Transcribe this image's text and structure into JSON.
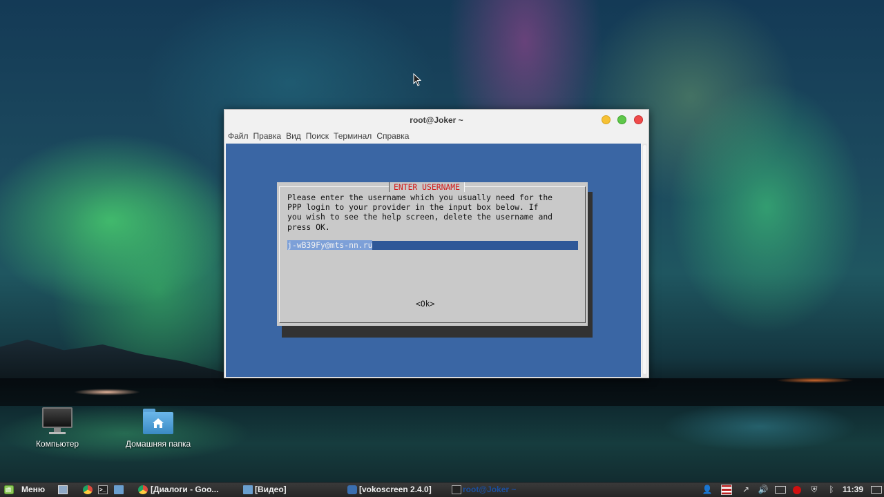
{
  "desktop": {
    "icons": [
      {
        "label": "Компьютер"
      },
      {
        "label": "Домашняя папка"
      }
    ]
  },
  "window": {
    "title": "root@Joker ~",
    "menu": [
      "Файл",
      "Правка",
      "Вид",
      "Поиск",
      "Терминал",
      "Справка"
    ]
  },
  "dialog": {
    "title": "ENTER USERNAME",
    "text": "Please enter the username which you usually need for the\nPPP login to your provider in the input box below. If\nyou wish to see the help screen, delete the username and\npress OK.",
    "input_value": "j-wB39Fy@mts-nn.ru",
    "ok_label": "<Ok>",
    "colors": {
      "background": "#3a66a4",
      "title": "#d11a1a",
      "dialog": "#c9c9c9"
    }
  },
  "taskbar": {
    "menu_label": "Меню",
    "tasks": [
      {
        "label": "[Диалоги - Goo...",
        "icon": "chrome-icon"
      },
      {
        "label": "[Видео]",
        "icon": "folder-icon"
      },
      {
        "label": "[vokoscreen 2.4.0]",
        "icon": "vokoscreen-icon"
      },
      {
        "label": "root@Joker ~",
        "icon": "terminal-icon"
      }
    ],
    "clock": "11:39"
  }
}
